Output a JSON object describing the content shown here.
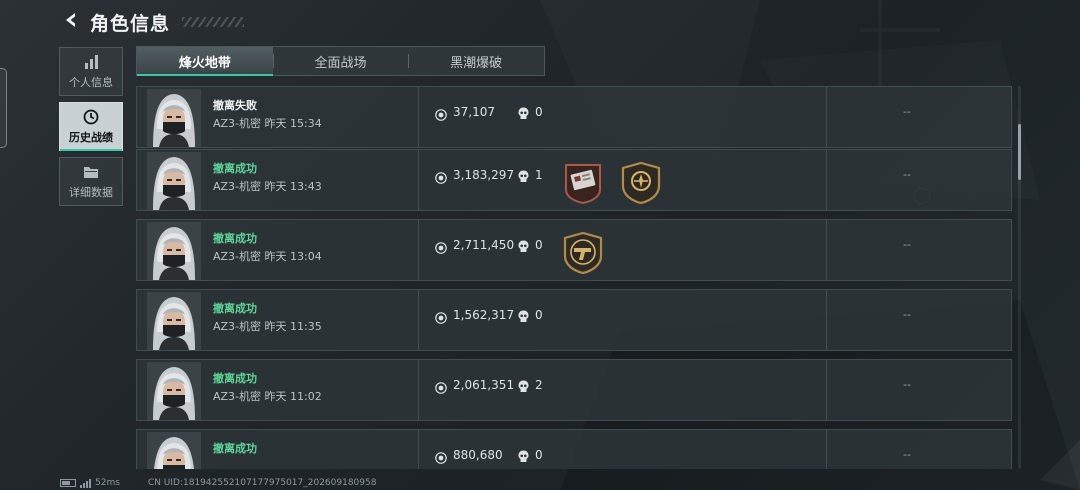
{
  "header": {
    "title": "角色信息",
    "back_icon": "chevron-left-icon"
  },
  "sidebar": {
    "items": [
      {
        "label": "个人信息",
        "icon": "bar-chart-icon",
        "active": false
      },
      {
        "label": "历史战绩",
        "icon": "clock-icon",
        "active": true
      },
      {
        "label": "详细数据",
        "icon": "folder-icon",
        "active": false
      }
    ]
  },
  "tabs": [
    {
      "label": "烽火地带",
      "active": true
    },
    {
      "label": "全面战场",
      "active": false
    },
    {
      "label": "黑潮爆破",
      "active": false
    }
  ],
  "records": [
    {
      "status": "撤离失败",
      "result": "fail",
      "meta": "AZ3-机密 昨天 15:34",
      "money": "37,107",
      "kills": "0",
      "badges": [],
      "extra": "--"
    },
    {
      "status": "撤离成功",
      "result": "success",
      "meta": "AZ3-机密 昨天 13:43",
      "money": "3,183,297",
      "kills": "1",
      "badges": [
        "red-card-badge-icon",
        "gold-emblem-badge-icon"
      ],
      "extra": "--"
    },
    {
      "status": "撤离成功",
      "result": "success",
      "meta": "AZ3-机密 昨天 13:04",
      "money": "2,711,450",
      "kills": "0",
      "badges": [
        "gold-pistol-badge-icon"
      ],
      "extra": "--"
    },
    {
      "status": "撤离成功",
      "result": "success",
      "meta": "AZ3-机密 昨天 11:35",
      "money": "1,562,317",
      "kills": "0",
      "badges": [],
      "extra": "--"
    },
    {
      "status": "撤离成功",
      "result": "success",
      "meta": "AZ3-机密 昨天 11:02",
      "money": "2,061,351",
      "kills": "2",
      "badges": [],
      "extra": "--"
    },
    {
      "status": "撤离成功",
      "result": "success",
      "meta": "",
      "money": "880,680",
      "kills": "0",
      "badges": [],
      "extra": "--"
    }
  ],
  "footer": {
    "ping": "52ms",
    "uid": "CN UID:181942552107177975017_202609180958"
  },
  "colors": {
    "success": "#5fd59a",
    "fail": "#f2f4f5",
    "accent": "#39c7a3",
    "badge_gold": "#b48a4a"
  }
}
